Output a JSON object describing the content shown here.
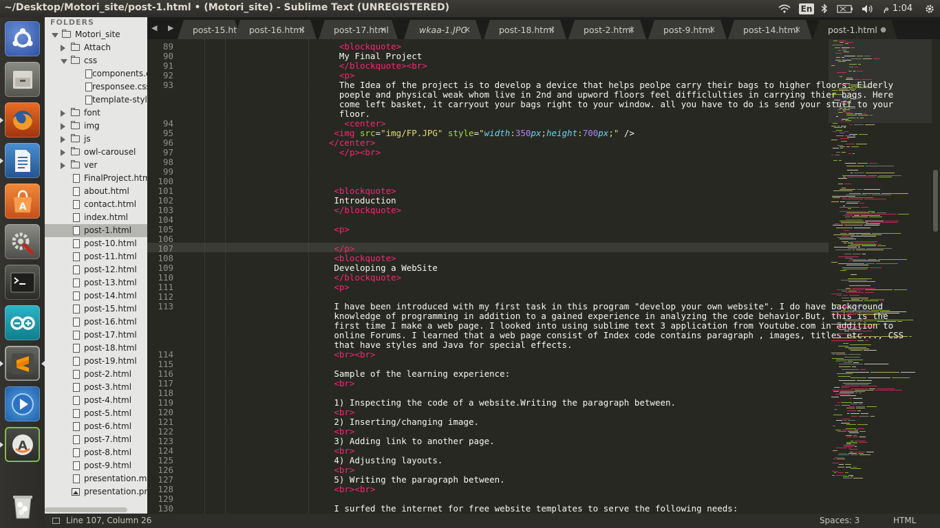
{
  "window": {
    "title": "~/Desktop/Motori_site/post-1.html • (Motori_site) - Sublime Text (UNREGISTERED)"
  },
  "system_tray": {
    "keyboard": "En",
    "time": "1:04",
    "ampm": "م"
  },
  "launcher": [
    {
      "name": "ubuntu-dash-icon"
    },
    {
      "name": "files-icon"
    },
    {
      "name": "firefox-icon"
    },
    {
      "name": "writer-icon"
    },
    {
      "name": "software-center-icon"
    },
    {
      "name": "settings-icon"
    },
    {
      "name": "terminal-icon"
    },
    {
      "name": "arduino-icon"
    },
    {
      "name": "sublime-text-icon"
    },
    {
      "name": "media-player-icon"
    },
    {
      "name": "updater-icon"
    },
    {
      "name": "trash-icon"
    }
  ],
  "sidebar": {
    "header": "FOLDERS",
    "items": [
      {
        "label": "Motori_site",
        "kind": "folder",
        "expanded": true,
        "depth": 0
      },
      {
        "label": "Attach",
        "kind": "folder",
        "expanded": false,
        "depth": 1
      },
      {
        "label": "css",
        "kind": "folder",
        "expanded": true,
        "depth": 1
      },
      {
        "label": "components.c",
        "kind": "file",
        "depth": 2
      },
      {
        "label": "responsee.css",
        "kind": "file",
        "depth": 2
      },
      {
        "label": "template-style",
        "kind": "file",
        "depth": 2
      },
      {
        "label": "font",
        "kind": "folder",
        "expanded": false,
        "depth": 1
      },
      {
        "label": "img",
        "kind": "folder",
        "expanded": false,
        "depth": 1
      },
      {
        "label": "js",
        "kind": "folder",
        "expanded": false,
        "depth": 1
      },
      {
        "label": "owl-carousel",
        "kind": "folder",
        "expanded": false,
        "depth": 1
      },
      {
        "label": "ver",
        "kind": "folder",
        "expanded": false,
        "depth": 1
      },
      {
        "label": "FinalProject.html",
        "kind": "file",
        "depth": 1
      },
      {
        "label": "about.html",
        "kind": "file",
        "depth": 1
      },
      {
        "label": "contact.html",
        "kind": "file",
        "depth": 1
      },
      {
        "label": "index.html",
        "kind": "file",
        "depth": 1
      },
      {
        "label": "post-1.html",
        "kind": "file",
        "depth": 1,
        "selected": true
      },
      {
        "label": "post-10.html",
        "kind": "file",
        "depth": 1
      },
      {
        "label": "post-11.html",
        "kind": "file",
        "depth": 1
      },
      {
        "label": "post-12.html",
        "kind": "file",
        "depth": 1
      },
      {
        "label": "post-13.html",
        "kind": "file",
        "depth": 1
      },
      {
        "label": "post-14.html",
        "kind": "file",
        "depth": 1
      },
      {
        "label": "post-15.html",
        "kind": "file",
        "depth": 1
      },
      {
        "label": "post-16.html",
        "kind": "file",
        "depth": 1
      },
      {
        "label": "post-17.html",
        "kind": "file",
        "depth": 1
      },
      {
        "label": "post-18.html",
        "kind": "file",
        "depth": 1
      },
      {
        "label": "post-19.html",
        "kind": "file",
        "depth": 1
      },
      {
        "label": "post-2.html",
        "kind": "file",
        "depth": 1
      },
      {
        "label": "post-3.html",
        "kind": "file",
        "depth": 1
      },
      {
        "label": "post-4.html",
        "kind": "file",
        "depth": 1
      },
      {
        "label": "post-5.html",
        "kind": "file",
        "depth": 1
      },
      {
        "label": "post-6.html",
        "kind": "file",
        "depth": 1
      },
      {
        "label": "post-7.html",
        "kind": "file",
        "depth": 1
      },
      {
        "label": "post-8.html",
        "kind": "file",
        "depth": 1
      },
      {
        "label": "post-9.html",
        "kind": "file",
        "depth": 1
      },
      {
        "label": "presentation.mp",
        "kind": "file",
        "depth": 1
      },
      {
        "label": "presentation.png",
        "kind": "image",
        "depth": 1
      }
    ]
  },
  "tabs": [
    {
      "label": "post-15.htr",
      "close": "",
      "active": false
    },
    {
      "label": "post-16.html",
      "close": "×",
      "active": false
    },
    {
      "label": "post-17.html",
      "close": "×",
      "active": false
    },
    {
      "label": "wkaa-1.JPG",
      "close": "×",
      "active": false,
      "italic": true
    },
    {
      "label": "post-18.html",
      "close": "×",
      "active": false
    },
    {
      "label": "post-2.html",
      "close": "×",
      "active": false
    },
    {
      "label": "post-9.html",
      "close": "×",
      "active": false
    },
    {
      "label": "post-14.html",
      "close": "×",
      "active": false
    },
    {
      "label": "post-1.html",
      "close": "●",
      "active": true
    }
  ],
  "tab_nav": "◀ ▶",
  "editor": {
    "current_line": 107,
    "lines": [
      {
        "n": "89",
        "i": 30,
        "s": [
          [
            "tag",
            "<blockquote>"
          ]
        ]
      },
      {
        "n": "90",
        "i": 30,
        "s": [
          [
            "t",
            "My Final Project"
          ]
        ]
      },
      {
        "n": "91",
        "i": 30,
        "s": [
          [
            "tag",
            "</blockquote><br>"
          ]
        ]
      },
      {
        "n": "92",
        "i": 30,
        "s": [
          [
            "tag",
            "<p>"
          ]
        ]
      },
      {
        "n": "93",
        "i": 30,
        "s": [
          [
            "t",
            "The Idea of the project is to develop a device that helps peolpe carry their bags to higher floors. Elderly"
          ]
        ]
      },
      {
        "n": "",
        "i": 30,
        "s": [
          [
            "t",
            "poeple and physical weak whom live in 2nd and upword floors feel difficlulties in carrying thier bags. Here"
          ]
        ]
      },
      {
        "n": "",
        "i": 30,
        "s": [
          [
            "t",
            "come left basket, it carryout your bags right to your window. all you have to do is send your stuff to your"
          ]
        ]
      },
      {
        "n": "",
        "i": 30,
        "s": [
          [
            "t",
            "floor."
          ]
        ]
      },
      {
        "n": "94",
        "i": 31,
        "s": [
          [
            "tag",
            "<center>"
          ]
        ]
      },
      {
        "n": "95",
        "i": 29,
        "s": [
          [
            "tag",
            "<img "
          ],
          [
            "attr",
            "src"
          ],
          [
            "t",
            "="
          ],
          [
            "str",
            "\"img/FP.JPG\""
          ],
          [
            "t",
            " "
          ],
          [
            "attr",
            "style"
          ],
          [
            "t",
            "="
          ],
          [
            "str",
            "\""
          ],
          [
            "prop",
            "width"
          ],
          [
            "str",
            ":"
          ],
          [
            "num",
            "350"
          ],
          [
            "prop",
            "px"
          ],
          [
            "str",
            ";"
          ],
          [
            "prop",
            "height"
          ],
          [
            "str",
            ":"
          ],
          [
            "num",
            "700"
          ],
          [
            "prop",
            "px"
          ],
          [
            "str",
            ";\""
          ],
          [
            "t",
            " />"
          ]
        ]
      },
      {
        "n": "96",
        "i": 28,
        "s": [
          [
            "tag",
            "</center>"
          ]
        ]
      },
      {
        "n": "97",
        "i": 30,
        "s": [
          [
            "tag",
            "</p><br>"
          ]
        ]
      },
      {
        "n": "98",
        "i": 0,
        "s": []
      },
      {
        "n": "99",
        "i": 0,
        "s": []
      },
      {
        "n": "100",
        "i": 0,
        "s": []
      },
      {
        "n": "101",
        "i": 29,
        "s": [
          [
            "tag",
            "<blockquote>"
          ]
        ]
      },
      {
        "n": "102",
        "i": 29,
        "s": [
          [
            "t",
            "Introduction"
          ]
        ]
      },
      {
        "n": "103",
        "i": 29,
        "s": [
          [
            "tag",
            "</blockquote>"
          ]
        ]
      },
      {
        "n": "104",
        "i": 0,
        "s": []
      },
      {
        "n": "105",
        "i": 29,
        "s": [
          [
            "tag",
            "<p>"
          ]
        ]
      },
      {
        "n": "106",
        "i": 0,
        "s": []
      },
      {
        "n": "107",
        "i": 29,
        "s": [
          [
            "tag",
            "</p>"
          ]
        ]
      },
      {
        "n": "108",
        "i": 29,
        "s": [
          [
            "tag",
            "<blockquote>"
          ]
        ]
      },
      {
        "n": "109",
        "i": 29,
        "s": [
          [
            "t",
            "Developing a WebSite"
          ]
        ]
      },
      {
        "n": "110",
        "i": 29,
        "s": [
          [
            "tag",
            "</blockquote>"
          ]
        ]
      },
      {
        "n": "111",
        "i": 29,
        "s": [
          [
            "tag",
            "<p>"
          ]
        ]
      },
      {
        "n": "112",
        "i": 0,
        "s": []
      },
      {
        "n": "113",
        "i": 29,
        "s": [
          [
            "t",
            "I have been introduced with my first task in this program \"develop your own website\". I do have background"
          ]
        ]
      },
      {
        "n": "",
        "i": 29,
        "s": [
          [
            "t",
            "knowledge of programming in addition to a gained experience in analyzing the code behavior.But, this is the"
          ]
        ]
      },
      {
        "n": "",
        "i": 29,
        "s": [
          [
            "t",
            "first time I make a web page. I looked into using sublime text 3 application from Youtube.com in addition to"
          ]
        ]
      },
      {
        "n": "",
        "i": 29,
        "s": [
          [
            "t",
            "online Forums. I learned that a web page consist of Index code contains paragraph , images, titles etc..., CSS"
          ]
        ]
      },
      {
        "n": "",
        "i": 29,
        "s": [
          [
            "t",
            "that have styles and Java for special effects."
          ]
        ]
      },
      {
        "n": "114",
        "i": 29,
        "s": [
          [
            "tag",
            "<br><br>"
          ]
        ]
      },
      {
        "n": "115",
        "i": 0,
        "s": []
      },
      {
        "n": "116",
        "i": 29,
        "s": [
          [
            "t",
            "Sample of the learning experience:"
          ]
        ]
      },
      {
        "n": "117",
        "i": 29,
        "s": [
          [
            "tag",
            "<br>"
          ]
        ]
      },
      {
        "n": "118",
        "i": 0,
        "s": []
      },
      {
        "n": "119",
        "i": 29,
        "s": [
          [
            "t",
            "1) Inspecting the code of a website.Writing the paragraph between."
          ]
        ]
      },
      {
        "n": "120",
        "i": 29,
        "s": [
          [
            "tag",
            "<br>"
          ]
        ]
      },
      {
        "n": "121",
        "i": 29,
        "s": [
          [
            "t",
            "2) Inserting/changing image."
          ]
        ]
      },
      {
        "n": "122",
        "i": 29,
        "s": [
          [
            "tag",
            "<br>"
          ]
        ]
      },
      {
        "n": "123",
        "i": 29,
        "s": [
          [
            "t",
            "3) Adding link to another page."
          ]
        ]
      },
      {
        "n": "124",
        "i": 29,
        "s": [
          [
            "tag",
            "<br>"
          ]
        ]
      },
      {
        "n": "125",
        "i": 29,
        "s": [
          [
            "t",
            "4) Adjusting layouts."
          ]
        ]
      },
      {
        "n": "126",
        "i": 29,
        "s": [
          [
            "tag",
            "<br>"
          ]
        ]
      },
      {
        "n": "127",
        "i": 29,
        "s": [
          [
            "t",
            "5) Writing the paragraph between."
          ]
        ]
      },
      {
        "n": "128",
        "i": 29,
        "s": [
          [
            "tag",
            "<br><br>"
          ]
        ]
      },
      {
        "n": "129",
        "i": 0,
        "s": []
      },
      {
        "n": "130",
        "i": 29,
        "s": [
          [
            "t",
            "I surfed the internet for free website templates to serve the following needs:"
          ]
        ]
      }
    ]
  },
  "status": {
    "position": "Line 107, Column 26",
    "spaces": "Spaces: 3",
    "syntax": "HTML"
  }
}
